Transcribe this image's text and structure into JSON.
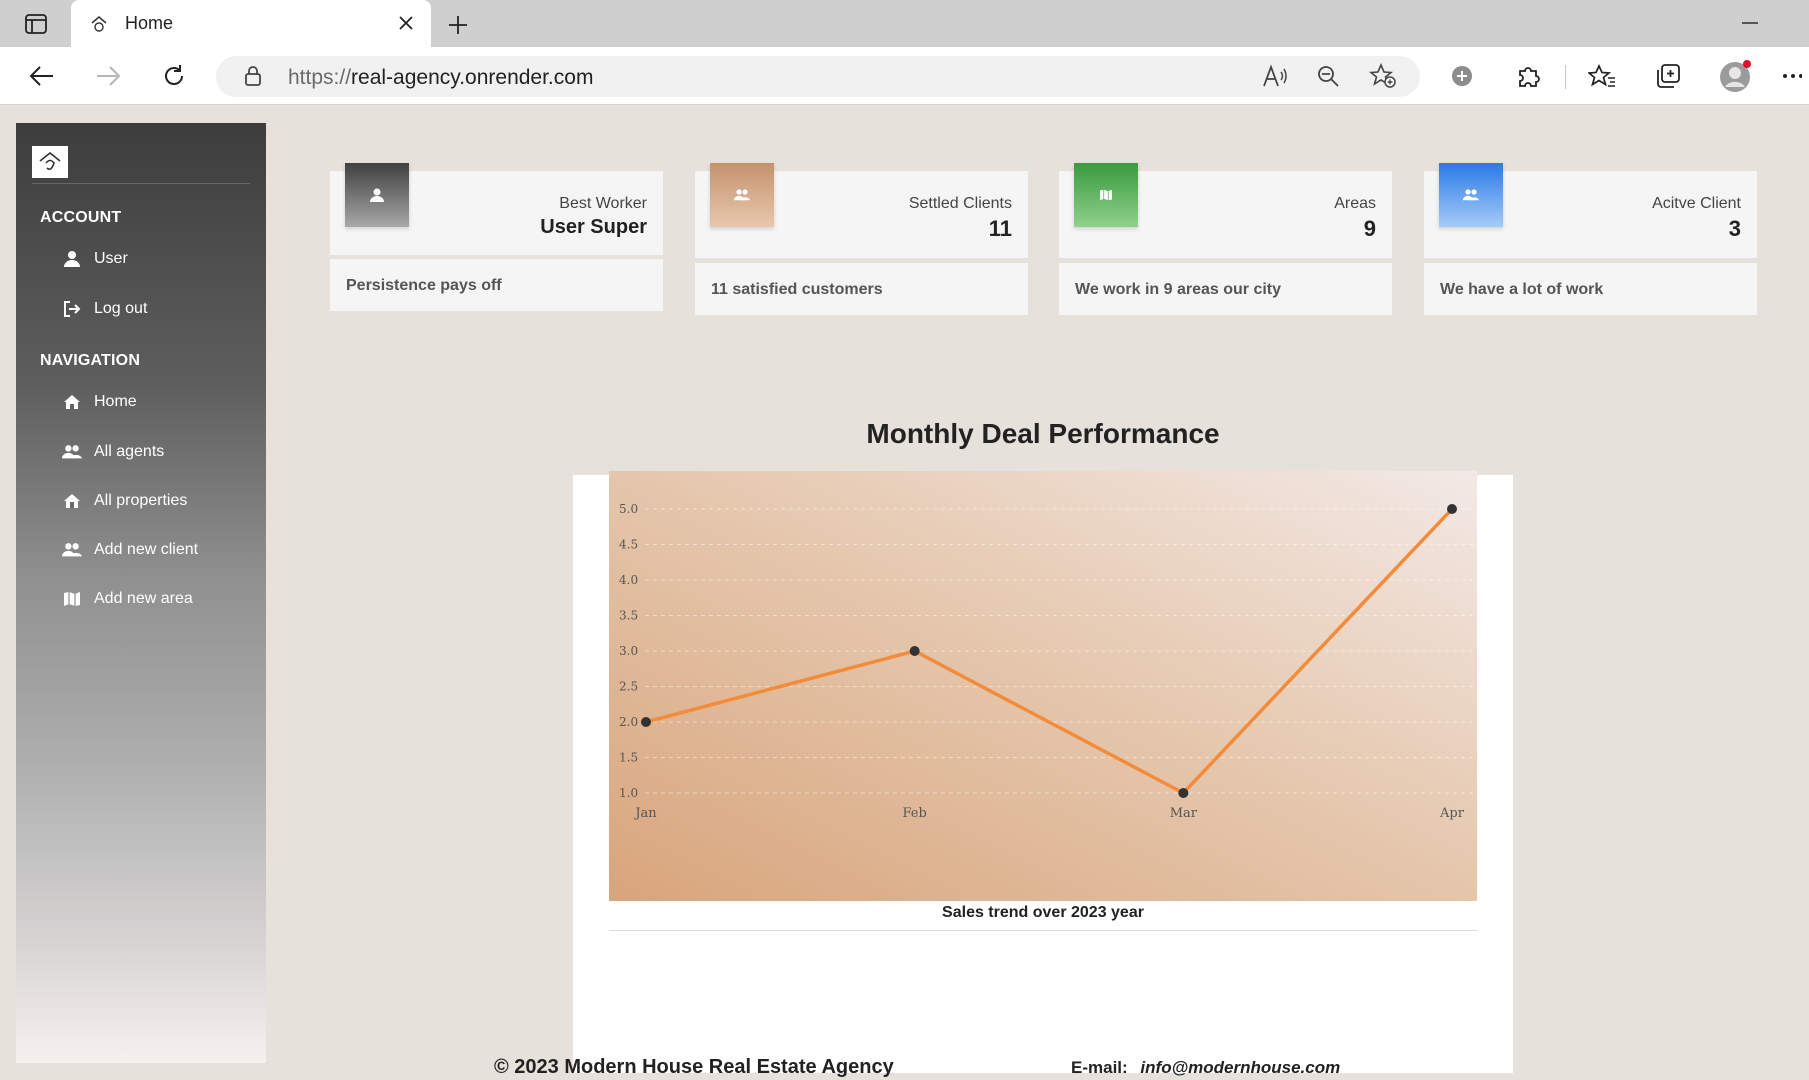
{
  "browser": {
    "tab_title": "Home",
    "url_scheme": "https://",
    "url_host": "real-agency.onrender.com"
  },
  "sidebar": {
    "account_title": "ACCOUNT",
    "account_items": [
      {
        "label": "User",
        "icon": "user-icon"
      },
      {
        "label": "Log out",
        "icon": "logout-icon"
      }
    ],
    "navigation_title": "NAVIGATION",
    "navigation_items": [
      {
        "label": "Home",
        "icon": "home-icon"
      },
      {
        "label": "All agents",
        "icon": "people-icon"
      },
      {
        "label": "All properties",
        "icon": "house-icon"
      },
      {
        "label": "Add new client",
        "icon": "people-icon"
      },
      {
        "label": "Add new area",
        "icon": "map-icon"
      }
    ]
  },
  "cards": [
    {
      "category": "Best Worker",
      "value": "User Super",
      "footer": "Persistence pays off",
      "icon": "user-icon",
      "color": "#555555"
    },
    {
      "category": "Settled Clients",
      "value": "11",
      "footer": "11 satisfied customers",
      "icon": "people-icon",
      "color": "#d7a47e"
    },
    {
      "category": "Areas",
      "value": "9",
      "footer": "We work in 9 areas our city",
      "icon": "map-icon",
      "color": "#43a047"
    },
    {
      "category": "Acitve Client",
      "value": "3",
      "footer": "We have a lot of work",
      "icon": "people-icon",
      "color": "#1e6fe0"
    }
  ],
  "chart": {
    "heading": "Monthly Deal Performance",
    "caption": "Sales trend over 2023 year"
  },
  "chart_data": {
    "type": "line",
    "categories": [
      "Jan",
      "Feb",
      "Mar",
      "Apr"
    ],
    "values": [
      2,
      3,
      1,
      5
    ],
    "ylim": [
      1,
      5
    ],
    "yticks": [
      "1.0",
      "1.5",
      "2.0",
      "2.5",
      "3.0",
      "3.5",
      "4.0",
      "4.5",
      "5.0"
    ],
    "grid": true,
    "line_color": "#f28c3a",
    "point_color": "#333333"
  },
  "footer": {
    "copyright": "© 2023 Modern House Real Estate Agency",
    "email_label": "E-mail:",
    "email": "info@modernhouse.com"
  }
}
